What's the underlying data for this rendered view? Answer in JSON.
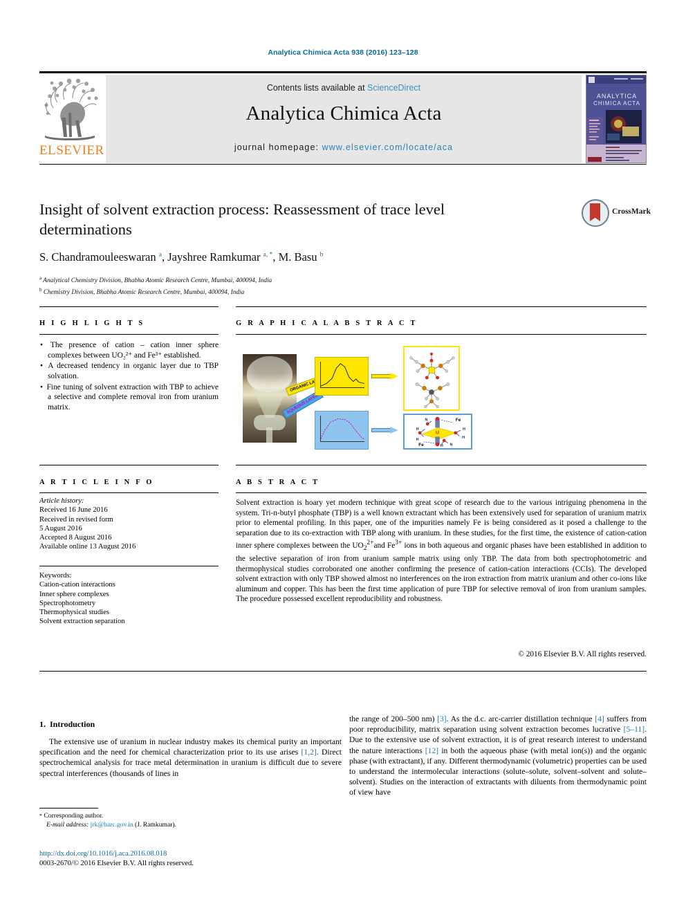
{
  "running_head": "Analytica Chimica Acta 938 (2016) 123–128",
  "header": {
    "publisher": "ELSEVIER",
    "contents_prefix": "Contents lists available at ",
    "contents_link": "ScienceDirect",
    "journal_title": "Analytica Chimica Acta",
    "homepage_label": "journal homepage: ",
    "homepage_url": "www.elsevier.com/locate/aca",
    "cover_title_line1": "ANALYTICA",
    "cover_title_line2": "CHIMICA ACTA",
    "link_color": "#3a8fc4",
    "band_color": "#e6e6e6",
    "elsevier_orange": "#ef7d18"
  },
  "article": {
    "title": "Insight of solvent extraction process: Reassessment of trace level determinations",
    "authors_html": "S. Chandramouleeswaran <sup>a</sup>, Jayshree Ramkumar <sup>a, *</sup>, M. Basu <sup>b</sup>",
    "affiliation_a": "Analytical Chemistry Division, Bhabha Atomic Research Centre, Mumbai, 400094, India",
    "affiliation_b": "Chemistry Division, Bhabha Atomic Research Centre, Mumbai, 400094, India",
    "crossmark_label": "CrossMark"
  },
  "sections": {
    "highlights_head": "H I G H L I G H T S",
    "graphical_abstract_head": "G R A P H I C A L   A B S T R A C T",
    "article_info_head": "A R T I C L E   I N F O",
    "abstract_head": "A B S T R A C T"
  },
  "highlights": [
    "The presence of cation – cation inner sphere complexes between UO₂²⁺ and Fe³⁺ established.",
    "A decreased tendency in organic layer due to TBP solvation.",
    "Fine tuning of solvent extraction with TBP to achieve a selective and complete removal iron from uranium matrix."
  ],
  "graphical_abstract": {
    "organic_tag": "ORGANIC LAYER",
    "aqueous_tag": "AQUEOUS LAYER",
    "organic_panel_color": "#ffe600",
    "aqueous_panel_color": "#8fc4ef",
    "struct_labels": [
      "Fe",
      "Fe",
      "U",
      "O",
      "O",
      "H",
      "H",
      "H",
      "N"
    ]
  },
  "article_info": {
    "history_label": "Article history:",
    "history": [
      "Received 16 June 2016",
      "Received in revised form",
      "5 August 2016",
      "Accepted 8 August 2016",
      "Available online 13 August 2016"
    ],
    "keywords_label": "Keywords:",
    "keywords": [
      "Cation-cation interactions",
      "Inner sphere complexes",
      "Spectrophotometry",
      "Thermophysical studies",
      "Solvent extraction separation"
    ]
  },
  "abstract": {
    "text_html": "Solvent extraction is hoary yet modern technique with great scope of research due to the various intriguing phenomena in the system. Tri-n-butyl phosphate (TBP) is a well known extractant which has been extensively used for separation of uranium matrix prior to elemental profiling. In this paper, one of the impurities namely Fe is being considered as it posed a challenge to the separation due to its co-extraction with TBP along with uranium. In these studies, for the first time, the existence of cation-cation inner sphere complexes between the UO<sub>2</sub><sup>2+</sup>and Fe<sup>3+</sup> ions in both aqueous and organic phases have been established in addition to the selective separation of iron from uranium sample matrix using only TBP. The data from both spectrophotometric and thermophysical studies corroborated one another confirming the presence of cation-cation interactions (CCIs). The developed solvent extraction with only TBP showed almost no interferences on the iron extraction from matrix uranium and other co-ions like aluminum and copper. This has been the first time application of pure TBP for selective removal of iron from uranium samples. The procedure possessed excellent reproducibility and robustness.",
    "copyright": "© 2016 Elsevier B.V. All rights reserved."
  },
  "body": {
    "intro_number": "1.",
    "intro_title": "Introduction",
    "left_html": "The extensive use of uranium in nuclear industry makes its chemical purity an important specification and the need for chemical characterization prior to its use arises <span class=\"lnk\">[1,2]</span>. Direct spectrochemical analysis for trace metal determination in uranium is difficult due to severe spectral interferences (thousands of lines in",
    "right_html": "the range of 200–500 nm) <span class=\"lnk\">[3]</span>. As the d.c. arc-carrier distillation technique <span class=\"lnk\">[4]</span> suffers from poor reproducibility, matrix separation using solvent extraction becomes lucrative <span class=\"lnk\">[5–11]</span>. Due to the extensive use of solvent extraction, it is of great research interest to understand the nature interactions <span class=\"lnk\">[12]</span> in both the aqueous phase (with metal ion(s)) and the organic phase (with extractant), if any. Different thermodynamic (volumetric) properties can be used to understand the intermolecular interactions (solute–solute, solvent–solvent and solute–solvent). Studies on the interaction of extractants with diluents from thermodynamic point of view have"
  },
  "footer": {
    "corresponding_marker": "*",
    "corresponding_label": "Corresponding author.",
    "email_label": "E-mail address:",
    "email": "jrk@barc.gov.in",
    "email_owner": "(J. Ramkumar).",
    "doi_url": "http://dx.doi.org/10.1016/j.aca.2016.08.018",
    "issn_line": "0003-2670/© 2016 Elsevier B.V. All rights reserved."
  }
}
